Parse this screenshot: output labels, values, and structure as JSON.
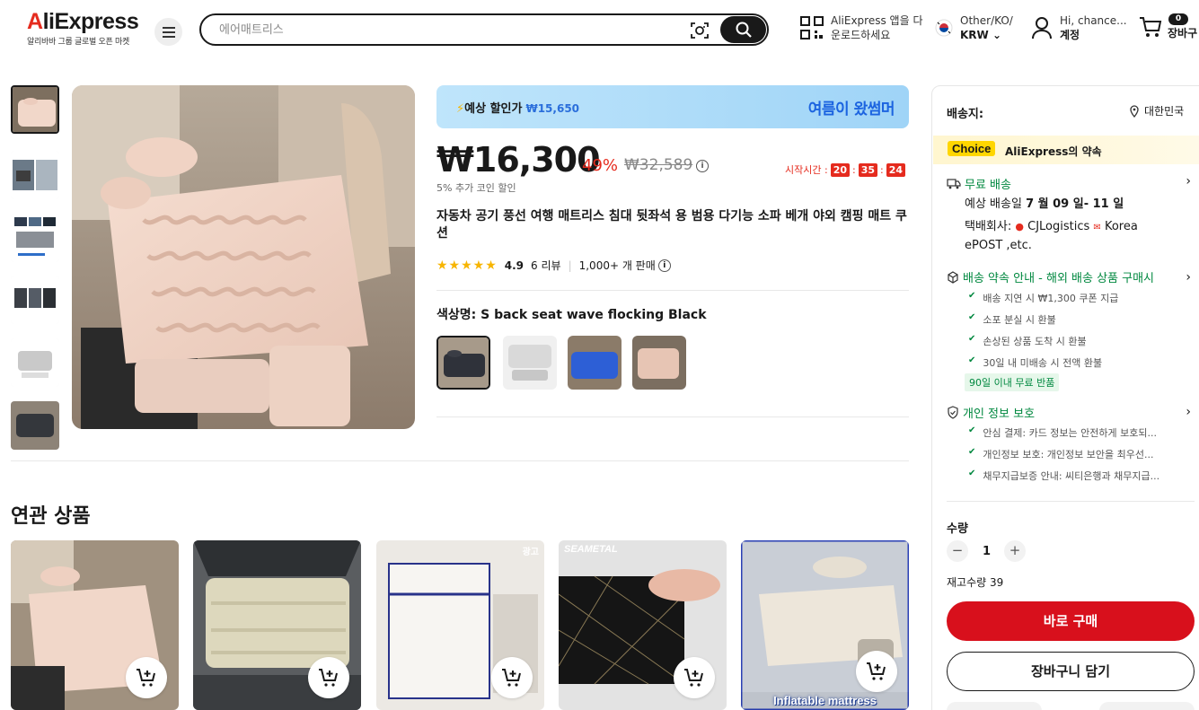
{
  "header": {
    "logo": "AliExpress",
    "logo_sub": "알리바바 그룹 글로벌 오픈 마켓",
    "search_placeholder": "에어매트리스",
    "app_line1": "AliExpress 앱을 다",
    "app_line2": "운로드하세요",
    "region_line1": "Other/KO/",
    "region_line2": "KRW",
    "account_line1": "Hi, chance...",
    "account_line2": "계정",
    "cart_count": "0",
    "cart_label": "장바구"
  },
  "product": {
    "promo_label": "예상 할인가",
    "promo_price": "₩15,650",
    "promo_banner": "여름이 왔썸머",
    "price": "₩16,300",
    "discount": "49%",
    "original_price": "₩32,589",
    "coin_text": "5% 추가 코인 할인",
    "timer_label": "시작시간 :",
    "timer_h": "20",
    "timer_m": "35",
    "timer_s": "24",
    "title": "자동차 공기 풍선 여행 매트리스 침대 뒷좌석 용 범용 다기능 소파 베개 야외 캠핑 매트 쿠션",
    "rating": "4.9",
    "reviews": "6 리뷰",
    "sold": "1,000+ 개 판매",
    "color_label": "색상명: S back seat wave flocking Black"
  },
  "related": {
    "title": "연관 상품",
    "card5_label": "Inflatable mattress",
    "card4_brand": "SEAMETAL",
    "card3_badge": "광고"
  },
  "panel": {
    "ship_to": "배송지:",
    "location": "대한민국",
    "choice_tag": "Choice",
    "choice_text": "AliExpress의 약속",
    "free_ship": "무료 배송",
    "eta_prefix": "예상 배송일",
    "eta_dates": "7 월 09 일- 11 일",
    "carrier_prefix": "택배회사:",
    "carrier1": "CJLogistics",
    "carrier2": "Korea",
    "carrier_line2": "ePOST ,etc.",
    "guarantee_title": "배송 약속 안내 - 해외 배송 상품 구매시",
    "guarantee_items": [
      "배송 지연 시 ₩1,300 쿠폰 지급",
      "소포 분실 시 환불",
      "손상된 상품 도착 시 환불",
      "30일 내 미배송 시 전액 환불"
    ],
    "return_tag": "90일 이내 무료 반품",
    "privacy_title": "개인 정보 보호",
    "privacy_items": [
      "안심 결제: 카드 정보는 안전하게 보호되...",
      "개인정보 보호: 개인정보 보안을 최우선...",
      "채무지급보증 안내: 씨티은행과 채무지급..."
    ],
    "qty_label": "수량",
    "qty_value": "1",
    "stock": "재고수량 39",
    "buy_now": "바로 구매",
    "add_to_cart": "장바구니 담기"
  },
  "colors": {
    "brand_red": "#e52b1e",
    "buy_red": "#d8101c",
    "green": "#00883f",
    "choice_yellow": "#ffd600",
    "promo_blue": "#1c64e0"
  },
  "icons": [
    "menu-icon",
    "camera-search-icon",
    "search-icon",
    "qr-code-icon",
    "korea-flag-icon",
    "user-icon",
    "cart-icon",
    "location-pin-icon",
    "truck-icon",
    "shield-box-icon",
    "shield-check-icon",
    "info-icon",
    "add-to-cart-icon",
    "lightning-icon"
  ]
}
